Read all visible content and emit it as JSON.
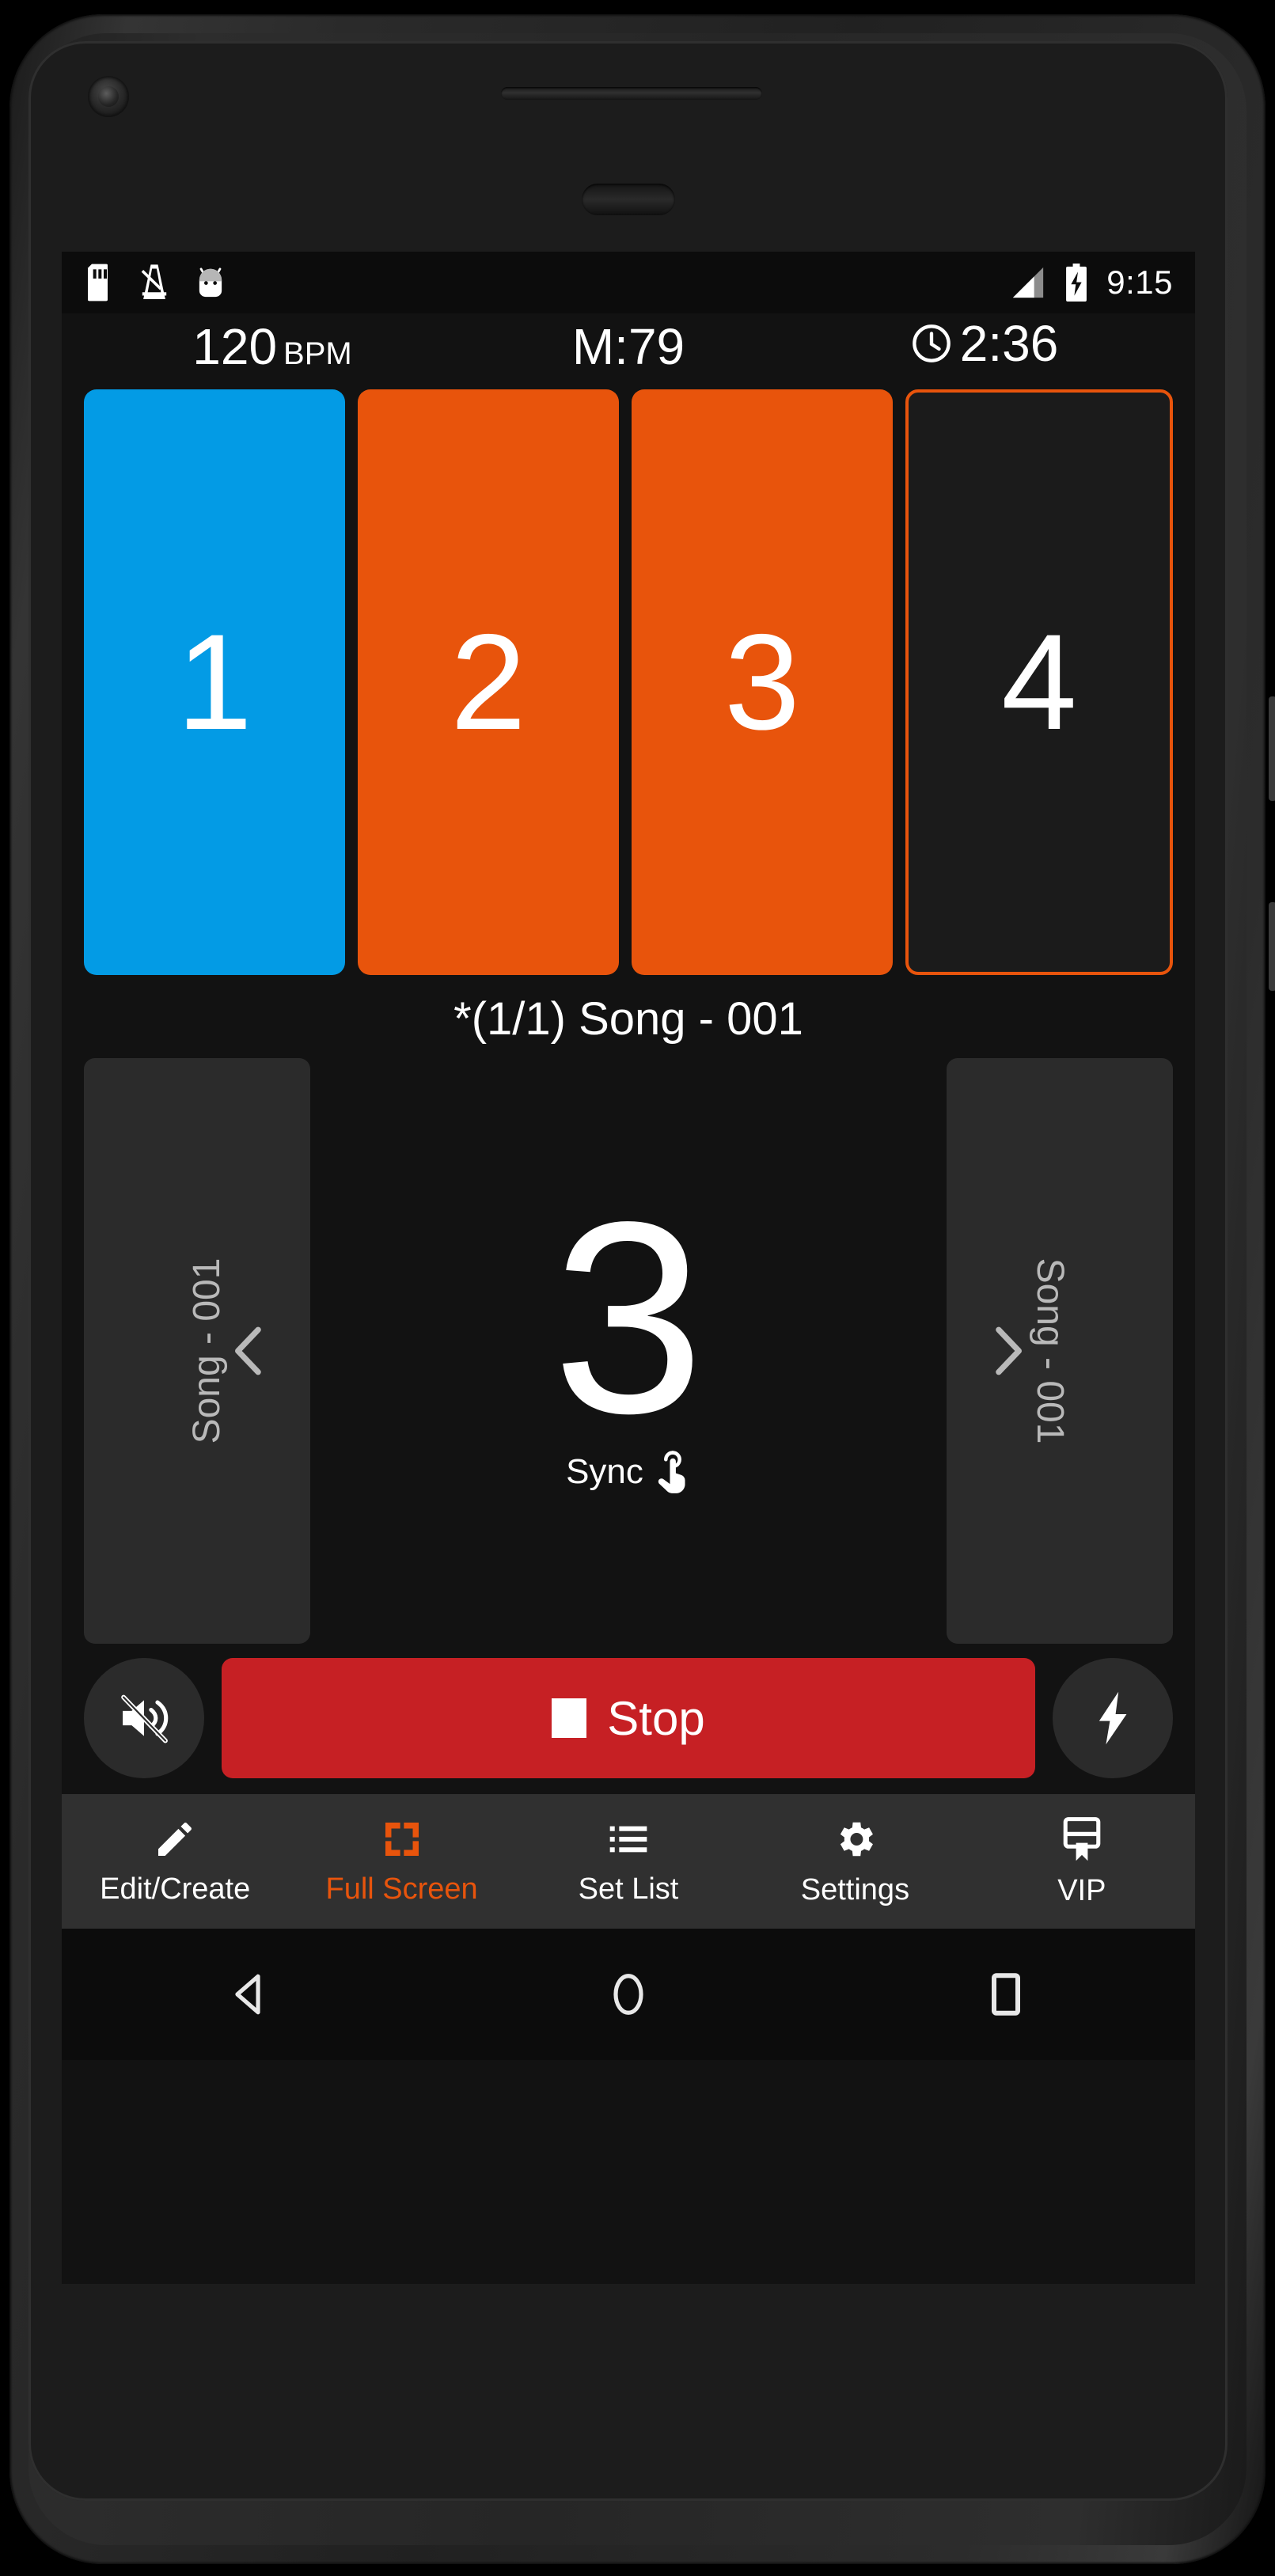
{
  "status_bar": {
    "icons": [
      "sd-card-icon",
      "metronome-icon",
      "android-head-icon"
    ],
    "signal_icon": "signal-bars-icon",
    "battery_icon": "battery-charging-icon",
    "clock": "9:15"
  },
  "info": {
    "bpm_value": "120",
    "bpm_unit": "BPM",
    "measure": "M:79",
    "elapsed_time": "2:36",
    "clock_icon": "clock-icon"
  },
  "beats": [
    {
      "label": "1",
      "state": "accent"
    },
    {
      "label": "2",
      "state": "active"
    },
    {
      "label": "3",
      "state": "active"
    },
    {
      "label": "4",
      "state": "idle"
    }
  ],
  "song": {
    "title": "*(1/1) Song - 001",
    "prev_label": "Song - 001",
    "next_label": "Song - 001",
    "prev_icon": "chevron-left-icon",
    "next_icon": "chevron-right-icon"
  },
  "counter": {
    "value": "3",
    "sync_label": "Sync",
    "sync_icon": "touch-hand-icon"
  },
  "transport": {
    "mute_icon": "volume-mute-icon",
    "stop_label": "Stop",
    "stop_icon": "stop-square-icon",
    "flash_icon": "flash-bolt-icon"
  },
  "bottom_nav": [
    {
      "label": "Edit/Create",
      "icon": "pencil-icon",
      "active": false
    },
    {
      "label": "Full Screen",
      "icon": "fullscreen-icon",
      "active": true
    },
    {
      "label": "Set List",
      "icon": "list-icon",
      "active": false
    },
    {
      "label": "Settings",
      "icon": "gear-icon",
      "active": false
    },
    {
      "label": "VIP",
      "icon": "vip-badge-icon",
      "active": false
    }
  ],
  "system_nav": {
    "back_icon": "back-triangle-icon",
    "home_icon": "home-circle-icon",
    "recents_icon": "recents-square-icon"
  },
  "colors": {
    "accent_blue": "#039be5",
    "accent_orange": "#e8540c",
    "stop_red": "#c62024",
    "screen_bg": "#121212",
    "panel_bg": "#2b2b2b",
    "nav_bg": "#303030"
  }
}
